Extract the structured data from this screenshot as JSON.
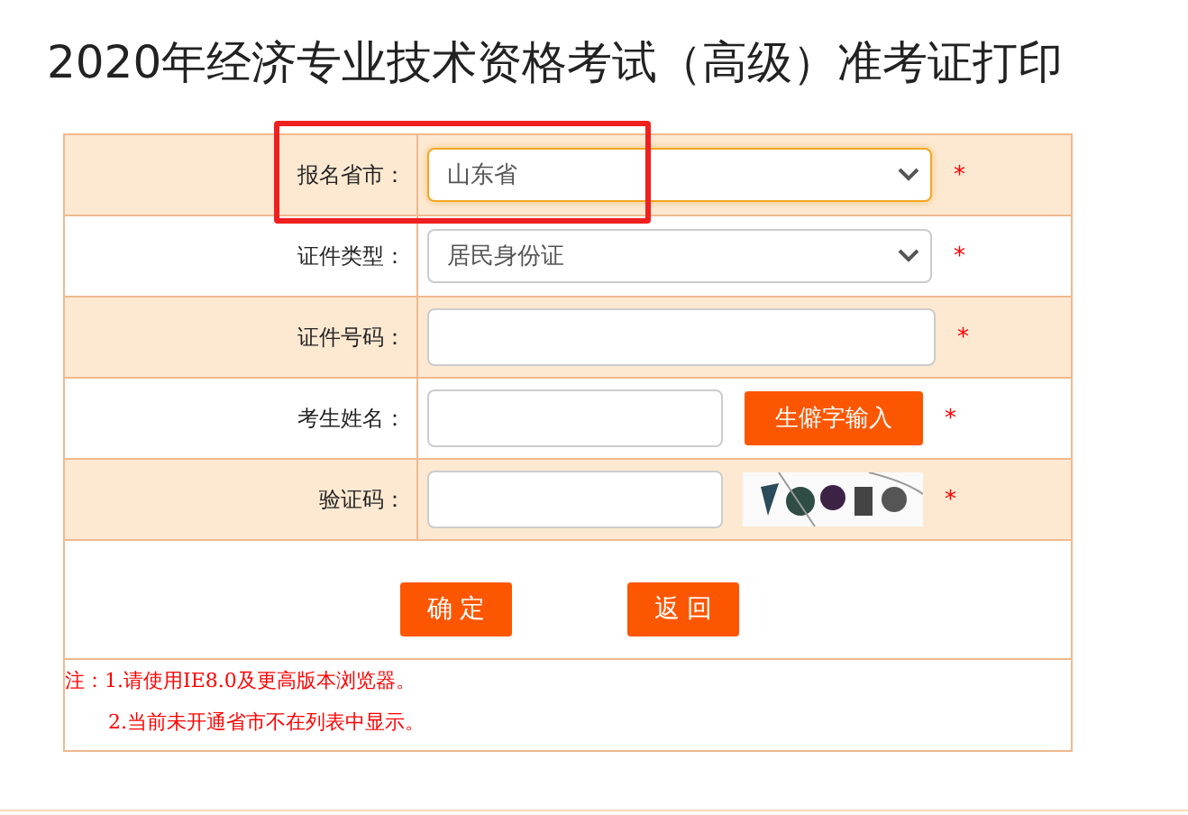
{
  "title": "2020年经济专业技术资格考试（高级）准考证打印",
  "fields": [
    {
      "kind": "select",
      "label": "报名省市：",
      "value": "山东省",
      "focused": true,
      "required": "*",
      "highlighted": true
    },
    {
      "kind": "select",
      "label": "证件类型：",
      "value": "居民身份证",
      "focused": false,
      "required": "*",
      "highlighted": false
    },
    {
      "kind": "text",
      "label": "证件号码：",
      "required": "*",
      "highlighted": false
    },
    {
      "kind": "name",
      "label": "考生姓名：",
      "button": "生僻字输入",
      "required": "*",
      "highlighted": false
    },
    {
      "kind": "captcha",
      "label": "验证码：",
      "required": "*",
      "highlighted": false
    }
  ],
  "buttons": [
    "确 定",
    "返 回"
  ],
  "notes": [
    "注：1.请使用IE8.0及更高版本浏览器。",
    "2.当前未开通省市不在列表中显示。"
  ]
}
